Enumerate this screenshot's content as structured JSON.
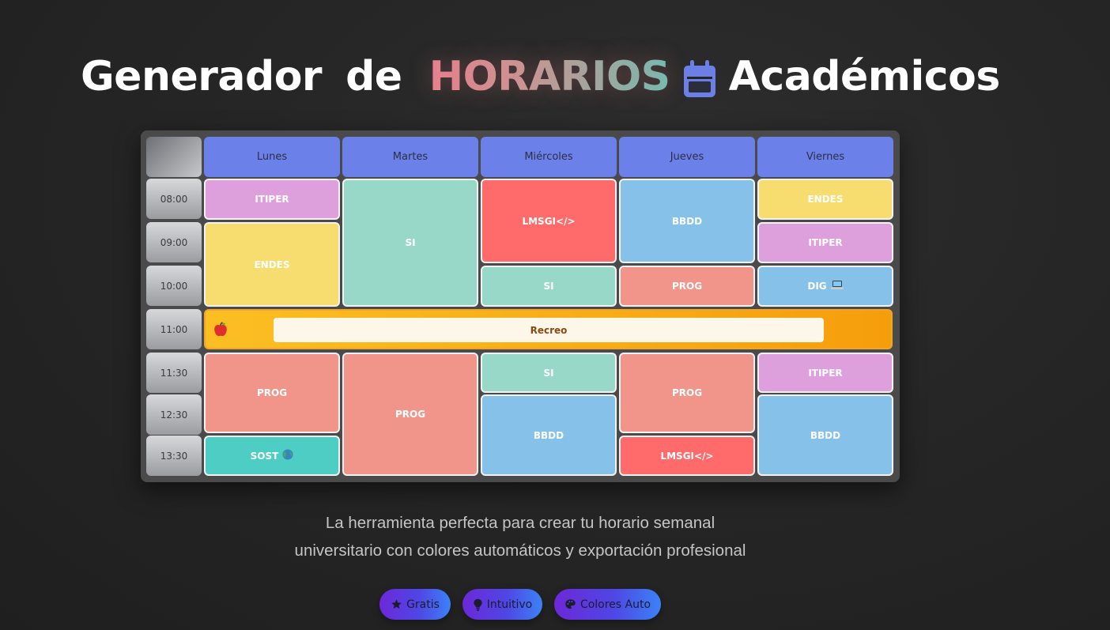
{
  "title": {
    "word1": "Generador",
    "word2": "de",
    "highlight": "HORARIOS",
    "icon": "calendar-icon",
    "word3": "Académicos"
  },
  "schedule": {
    "days": [
      "Lunes",
      "Martes",
      "Miércoles",
      "Jueves",
      "Viernes"
    ],
    "times": [
      "08:00",
      "09:00",
      "10:00",
      "11:00",
      "11:30",
      "12:30",
      "13:30"
    ],
    "break": {
      "label": "Recreo",
      "icon": "apple-icon",
      "color": "#fbbf23"
    },
    "subject_colors": {
      "ITIPER": "#dda0dd",
      "ENDES": "#f7dc6f",
      "SI": "#98d8c8",
      "LMSGI": "#ff6b6b",
      "BBDD": "#85c1e9",
      "PROG": "#f1948a",
      "DIG": "#85c1e9",
      "SOST": "#4ecdc4"
    },
    "cells": {
      "lunes_0800": "ITIPER",
      "lunes_0900": "ENDES",
      "martes_0800": "SI",
      "miercoles_0800": "LMSGI</>",
      "miercoles_1000": "SI",
      "jueves_0800": "BBDD",
      "jueves_1000": "PROG",
      "viernes_0800": "ENDES",
      "viernes_0900": "ITIPER",
      "viernes_1000": "DIG",
      "lunes_1130": "PROG",
      "lunes_1330": "SOST",
      "martes_1130": "PROG",
      "miercoles_1130": "SI",
      "miercoles_1230": "BBDD",
      "jueves_1130": "PROG",
      "jueves_1330": "LMSGI</>",
      "viernes_1130": "ITIPER",
      "viernes_1230": "BBDD"
    },
    "cell_icons": {
      "viernes_1000": "laptop-icon",
      "lunes_1330": "globe-icon"
    }
  },
  "tagline": {
    "line1": "La herramienta perfecta para crear tu horario semanal",
    "line2": "universitario con colores automáticos y exportación profesional"
  },
  "badges": [
    {
      "label": "Gratis",
      "icon": "star-icon"
    },
    {
      "label": "Intuitivo",
      "icon": "lightbulb-icon"
    },
    {
      "label": "Colores Auto",
      "icon": "palette-icon"
    }
  ]
}
